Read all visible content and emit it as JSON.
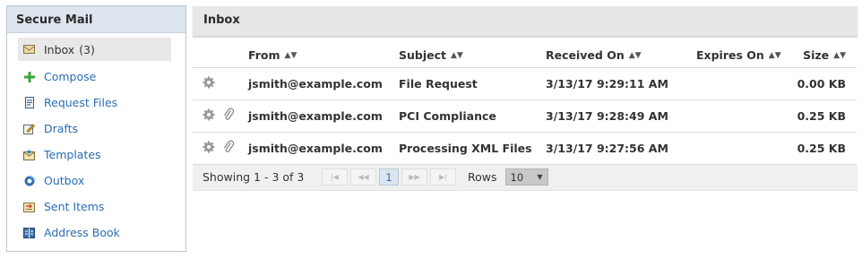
{
  "sidebar": {
    "title": "Secure Mail",
    "inbox": {
      "label": "Inbox",
      "count": "(3)"
    },
    "items": [
      {
        "label": "Compose",
        "icon": "plus-icon"
      },
      {
        "label": "Request Files",
        "icon": "request-files-icon"
      },
      {
        "label": "Drafts",
        "icon": "pencil-icon"
      },
      {
        "label": "Templates",
        "icon": "template-icon"
      },
      {
        "label": "Outbox",
        "icon": "outbox-icon"
      },
      {
        "label": "Sent Items",
        "icon": "sent-items-icon"
      },
      {
        "label": "Address Book",
        "icon": "address-book-icon"
      }
    ]
  },
  "main": {
    "title": "Inbox",
    "columns": {
      "from": "From",
      "subject": "Subject",
      "received": "Received On",
      "expires": "Expires On",
      "size": "Size"
    },
    "rows": [
      {
        "from": "jsmith@example.com",
        "subject": "File Request",
        "received": "3/13/17 9:29:11 AM",
        "expires": "",
        "size": "0.00 KB",
        "attachment": false
      },
      {
        "from": "jsmith@example.com",
        "subject": "PCI Compliance",
        "received": "3/13/17 9:28:49 AM",
        "expires": "",
        "size": "0.25 KB",
        "attachment": true
      },
      {
        "from": "jsmith@example.com",
        "subject": "Processing XML Files",
        "received": "3/13/17 9:27:56 AM",
        "expires": "",
        "size": "0.25 KB",
        "attachment": true
      }
    ],
    "pager": {
      "info": "Showing 1 - 3 of 3",
      "page": "1",
      "rows_label": "Rows",
      "rows_value": "10"
    }
  },
  "colors": {
    "link": "#2a6db5",
    "header_bg": "#e7e7e7",
    "sidebar_header_bg": "#dde5ee"
  }
}
